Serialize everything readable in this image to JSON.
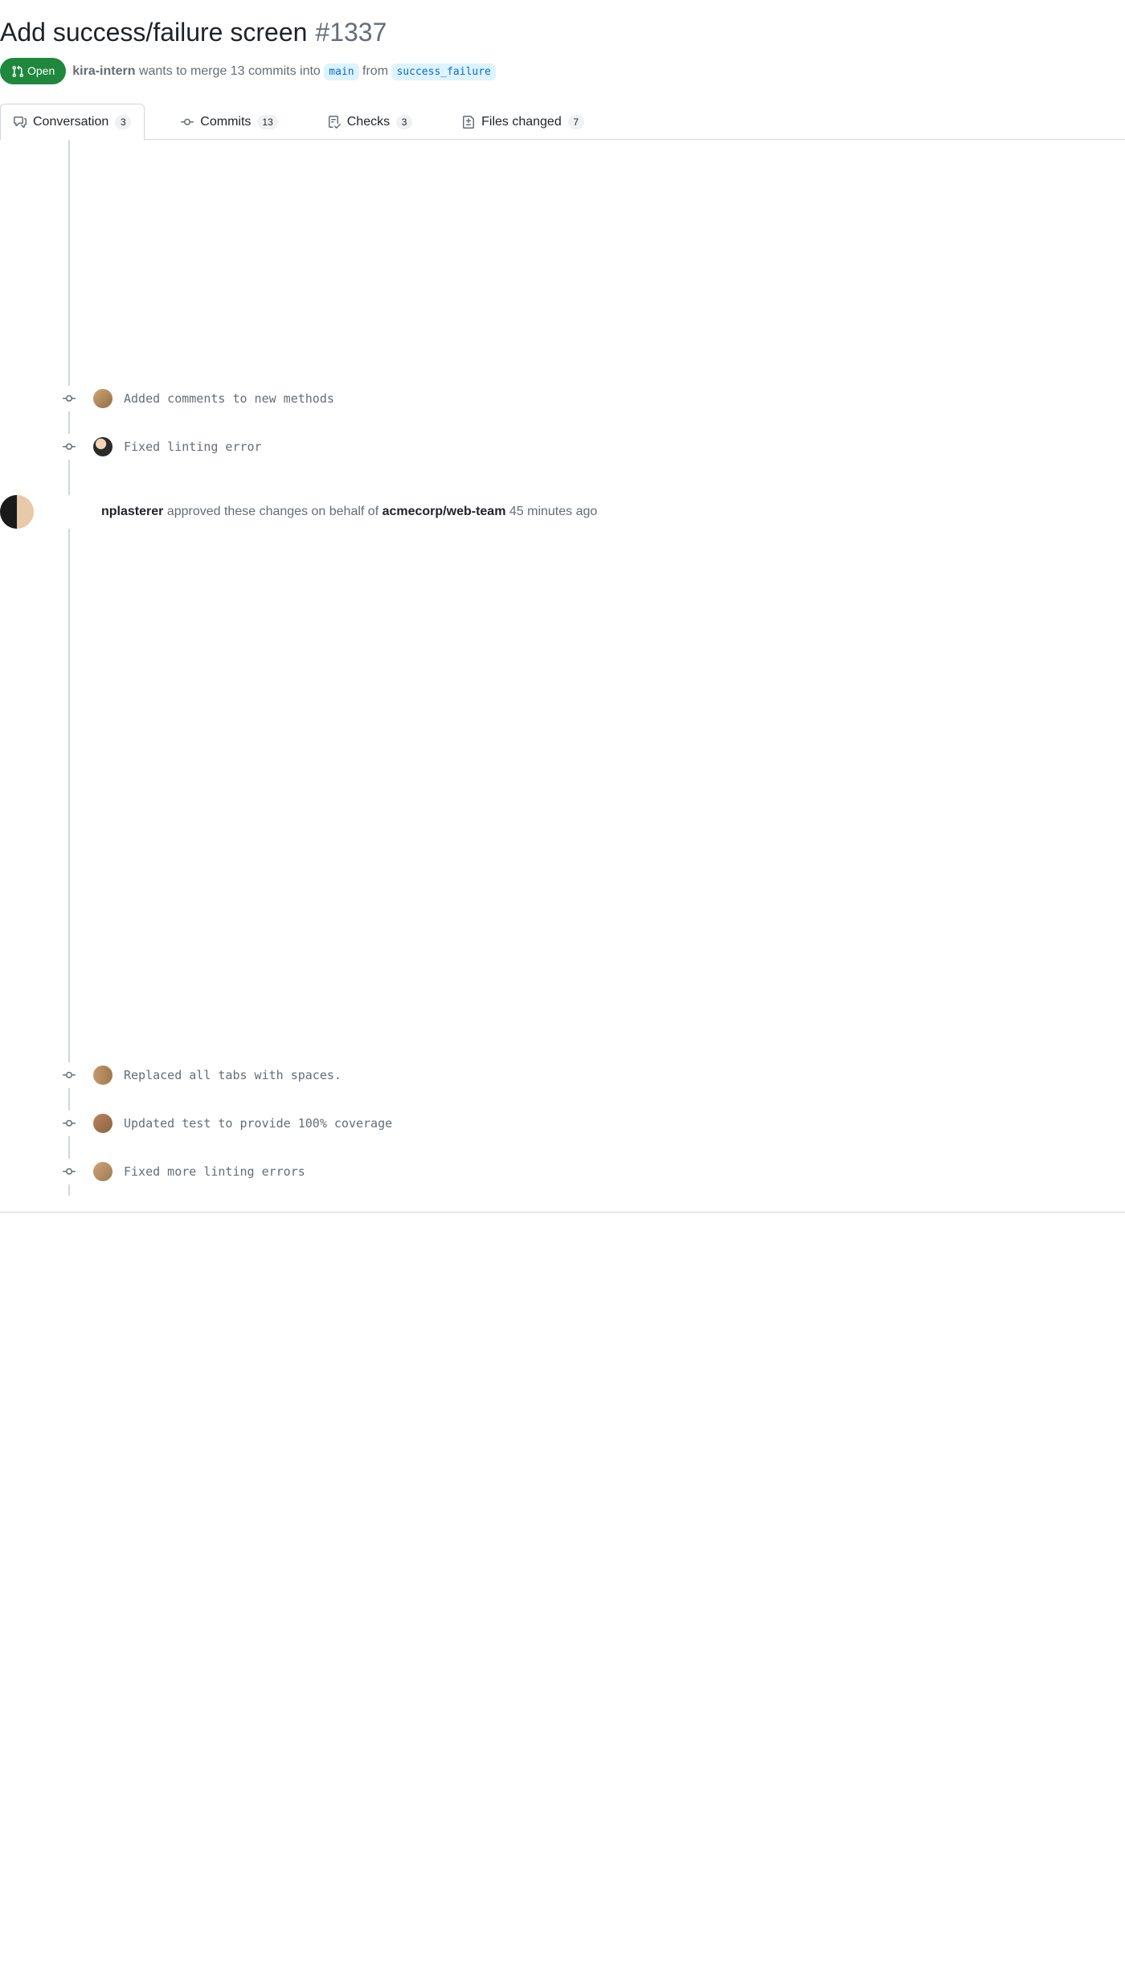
{
  "pr": {
    "title": "Add success/failure screen",
    "number": "#1337",
    "state": "Open",
    "author": "kira-intern",
    "merge_text_prefix": "wants to merge ",
    "commit_count_text": "13 commits",
    "into_text": " into ",
    "base_branch": "main",
    "from_text": " from ",
    "head_branch": "success_failure"
  },
  "tabs": {
    "conversation": {
      "label": "Conversation",
      "count": "3"
    },
    "commits": {
      "label": "Commits",
      "count": "13"
    },
    "checks": {
      "label": "Checks",
      "count": "3"
    },
    "files": {
      "label": "Files changed",
      "count": "7"
    }
  },
  "timeline": {
    "commits_top": [
      {
        "message": "Added comments to new methods",
        "avatar": "av1"
      },
      {
        "message": "Fixed linting error",
        "avatar": "av2"
      }
    ],
    "review": {
      "user": "nplasterer",
      "action_prefix": " approved these changes on behalf of ",
      "team": "acmecorp/web-team",
      "time": " 45 minutes ago"
    },
    "commits_bottom": [
      {
        "message": "Replaced all tabs with spaces.",
        "avatar": "av3"
      },
      {
        "message": "Updated test to provide 100% coverage",
        "avatar": "av4"
      },
      {
        "message": "Fixed more linting errors",
        "avatar": "av5"
      }
    ]
  }
}
